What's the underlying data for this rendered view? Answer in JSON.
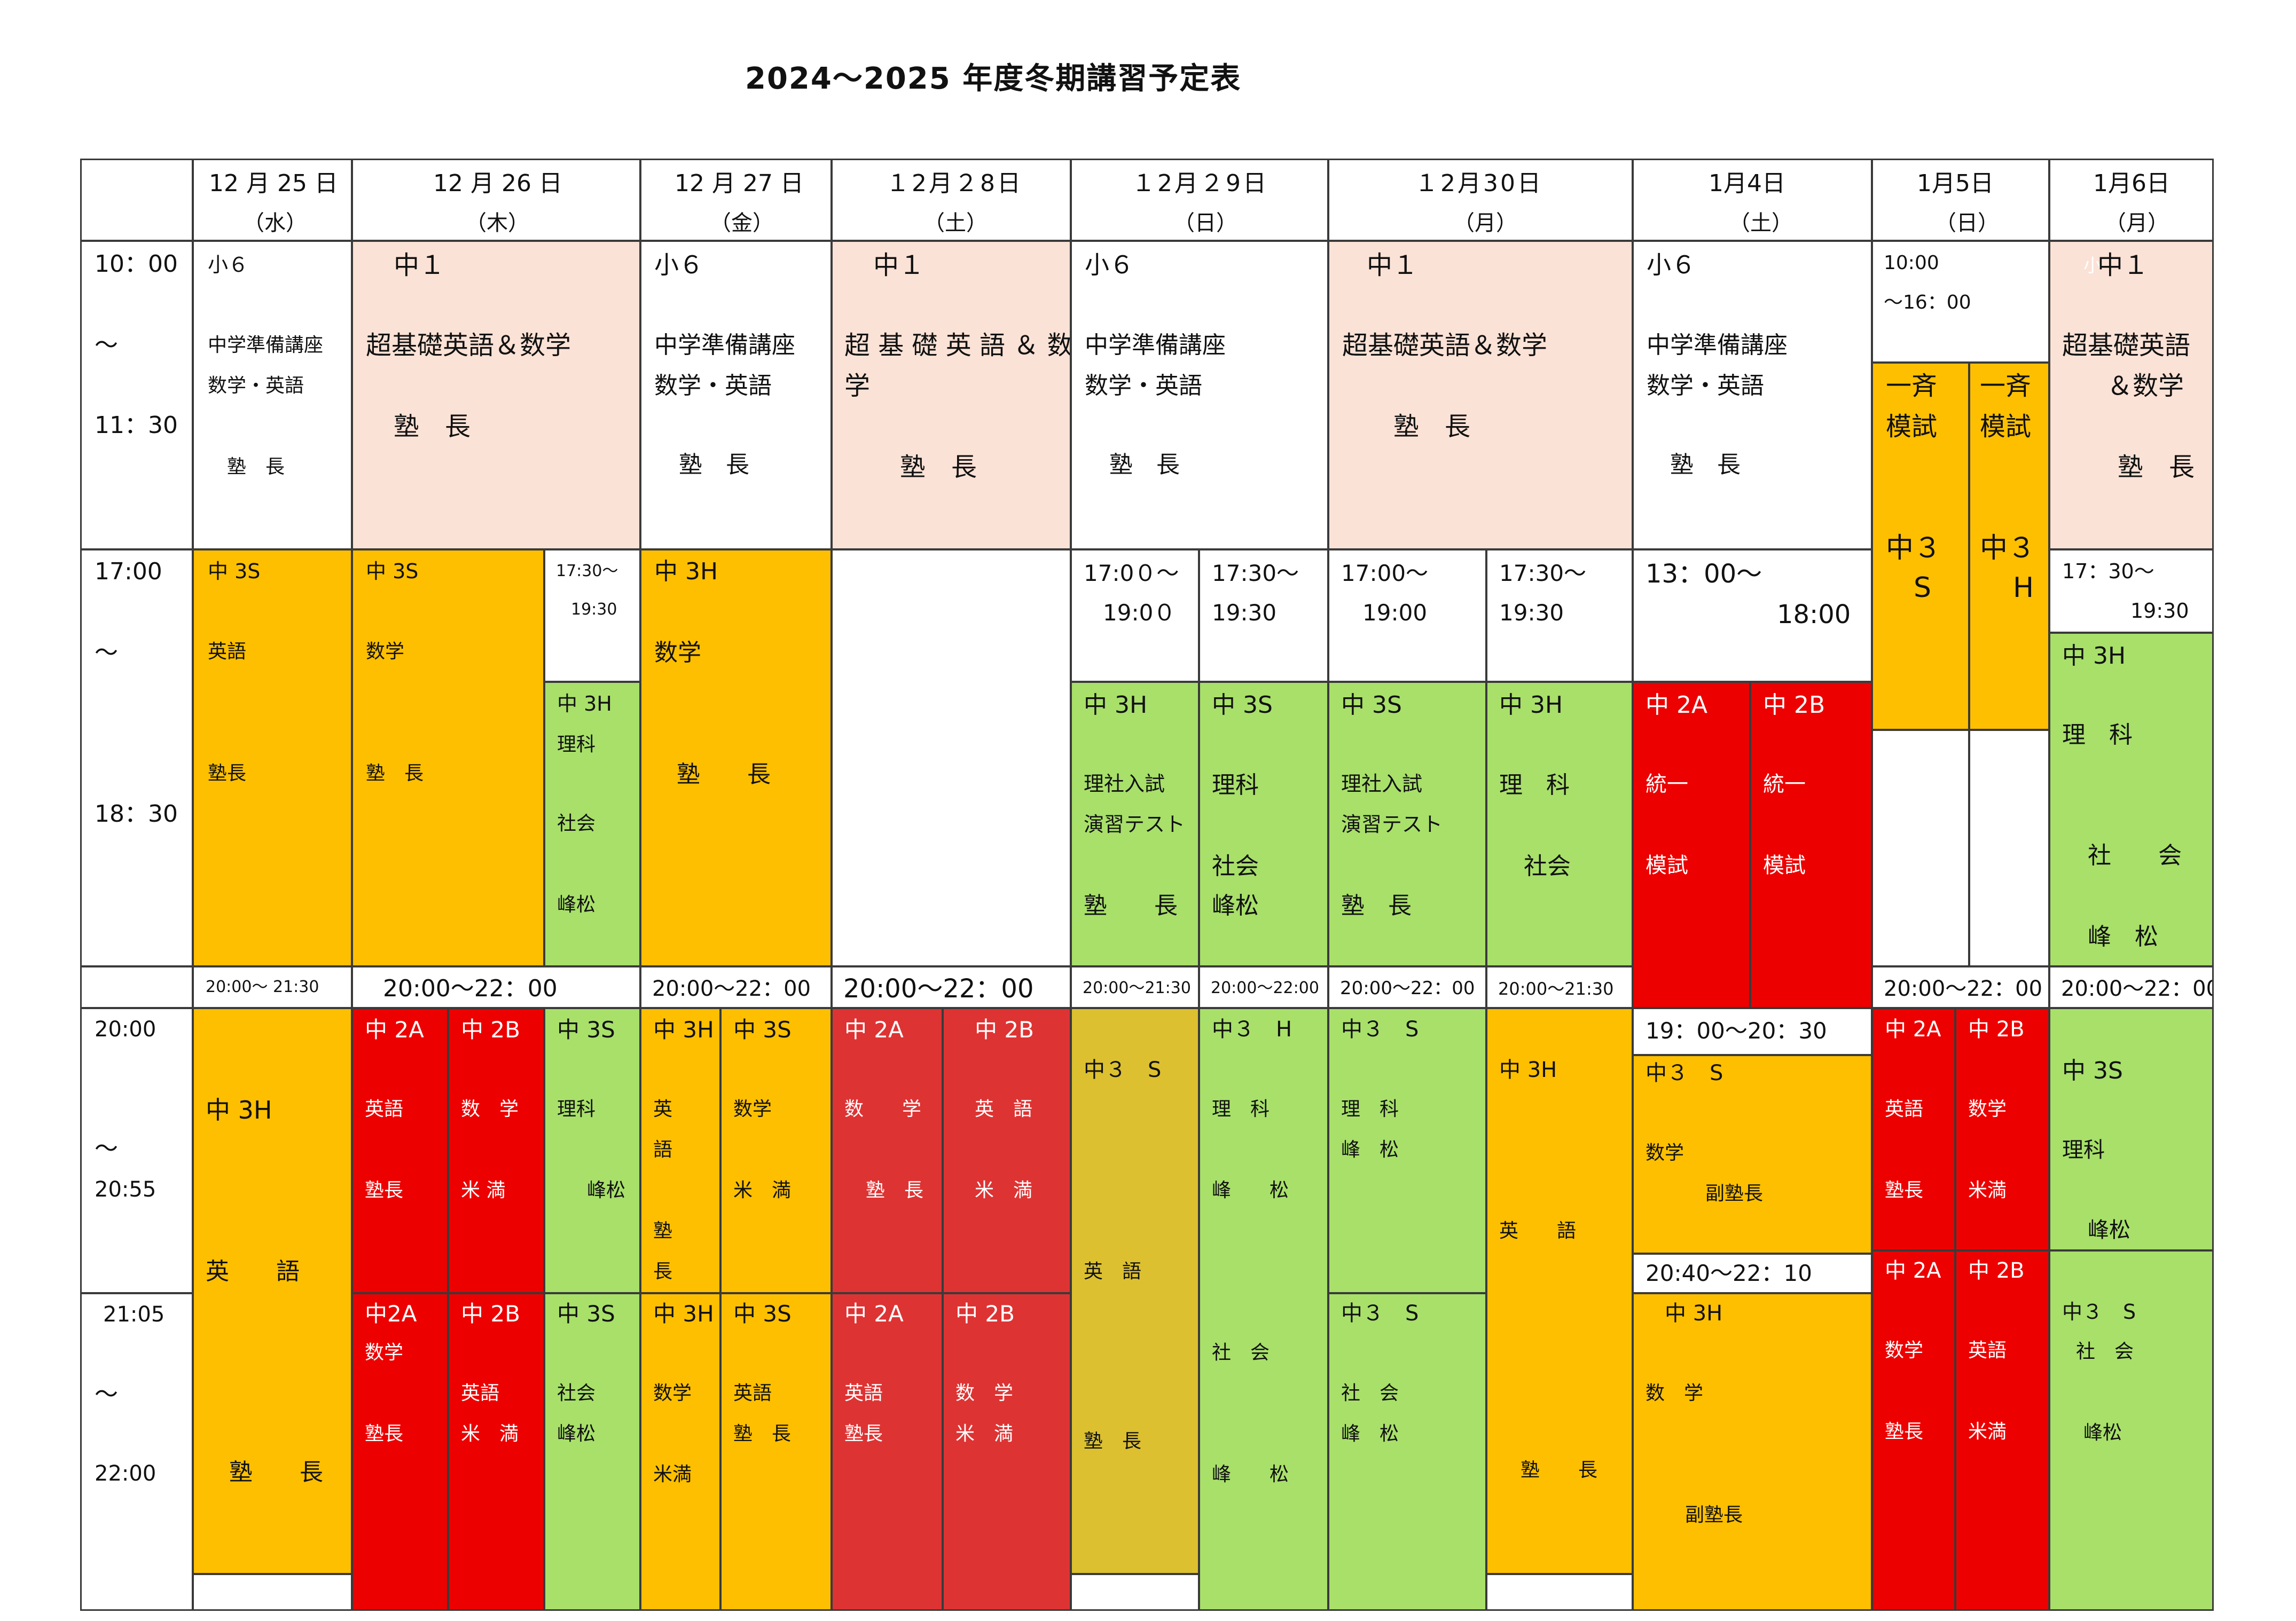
{
  "title": "2024～2025 年度冬期講習予定表",
  "header": {
    "d1": {
      "date": "12 月 25 日",
      "dow": "（水）"
    },
    "d2": {
      "date": "12 月 26 日",
      "dow": "（木）"
    },
    "d3": {
      "date": "12 月 27 日",
      "dow": "（金）"
    },
    "d4": {
      "date": "１2月２8日",
      "dow": "（土）"
    },
    "d5": {
      "date": "１2月２9日",
      "dow": "（日）"
    },
    "d6": {
      "date": "１2月30日",
      "dow": "（月）"
    },
    "d7": {
      "date": "1月4日",
      "dow": "（土）"
    },
    "d8": {
      "date": "1月5日",
      "dow": "（日）"
    },
    "d9": {
      "date": "1月6日",
      "dow": "（月）"
    }
  },
  "times": {
    "morning": {
      "start": "10：00",
      "tilde": "～",
      "end": "11：30"
    },
    "evening": {
      "start": "17:00",
      "tilde": "～",
      "end": "18：30"
    },
    "night1": {
      "start": "20:00",
      "tilde": "～",
      "end": "20:55"
    },
    "night2": {
      "start": "21:05",
      "tilde": "～",
      "end": "22:00"
    }
  },
  "morning": {
    "d1": {
      "l1": "小６",
      "l2": "中学準備講座",
      "l3": "数学・英語",
      "l4": "塾　長"
    },
    "d2": {
      "l1": "中１",
      "l2": "超基礎英語＆数学",
      "l3": "塾　長"
    },
    "d3": {
      "l1": "小６",
      "l2": "中学準備講座",
      "l3": "数学・英語",
      "l4": "塾　長"
    },
    "d4": {
      "l1": "中１",
      "l2": "超 基 礎 英 語 ＆ 数",
      "l3": "学",
      "l4": "塾　長"
    },
    "d5": {
      "l1": "小６",
      "l2": "中学準備講座",
      "l3": "数学・英語",
      "l4": "塾　長"
    },
    "d6": {
      "l1": "中１",
      "l2": "超基礎英語＆数学",
      "l3": "塾　長"
    },
    "d7": {
      "l1": "小６",
      "l2": "中学準備講座",
      "l3": "数学・英語",
      "l4": "塾　長"
    },
    "d8": {
      "time1": "10:00",
      "time2": "～16：00"
    },
    "d8a": {
      "l1": "一斉",
      "l2": "模試",
      "l3": "中３",
      "l4": "S"
    },
    "d8b": {
      "l1": "一斉",
      "l2": "模試",
      "l3": "中３",
      "l4": "H"
    },
    "d9": {
      "prefix": "小",
      "l1": "中１",
      "l2": "超基礎英語",
      "l3": "＆数学",
      "l4": "塾　長"
    }
  },
  "evening": {
    "d1": {
      "l1": "中 3S",
      "l2": "英語",
      "l3": "塾長"
    },
    "d2a": {
      "l1": "中 3S",
      "l2": "数学",
      "l3": "塾　長"
    },
    "d2b_time": {
      "l1": "17:30～",
      "l2": "19:30"
    },
    "d2b": {
      "l1": "中 3H",
      "l2": "理科",
      "l3": "社会",
      "l4": "峰松"
    },
    "d3": {
      "l1": "中 3H",
      "l2": "数学",
      "l3": "塾　　長"
    },
    "d5a_time": {
      "l1": "17:0０～",
      "l2": "19:0０"
    },
    "d5b_time": {
      "l1": "17:30～",
      "l2": "19:30"
    },
    "d6a_time": {
      "l1": "17:00～",
      "l2": "19:00"
    },
    "d6b_time": {
      "l1": "17:30～",
      "l2": "19:30"
    },
    "d7_time": {
      "l1": "13：00～",
      "l2": "18:00"
    },
    "d9_time": {
      "l1": "17：30～",
      "l2": "19:30"
    },
    "d5a": {
      "l1": "中 3H",
      "l2": "理社入試",
      "l3": "演習テスト",
      "l4": "塾　　長"
    },
    "d5b": {
      "l1": "中 3S",
      "l2": "理科",
      "l3": "社会",
      "l4": "峰松"
    },
    "d6a": {
      "l1": "中 3S",
      "l2": "理社入試",
      "l3": "演習テスト",
      "l4": "塾　長"
    },
    "d6b": {
      "l1": "中 3H",
      "l2": "理　科",
      "l3": "社会"
    },
    "d7a": {
      "l1": "中 2A",
      "l2": "統一",
      "l3": "模試"
    },
    "d7b": {
      "l1": "中 2B",
      "l2": "統一",
      "l3": "模試"
    },
    "d9": {
      "l1": "中 3H",
      "l2": "理　科",
      "l3": "社　　会",
      "l4": "峰　松"
    }
  },
  "night_times": {
    "d1": "20:00～ 21:30",
    "d2": "20:00～22：00",
    "d3": "20:00～22：00",
    "d4": "20:00～22：00",
    "d5a": "20:00～21:30",
    "d5b": "20:00～22:00",
    "d6a": "20:00～22：00",
    "d6b": "20:00～21:30",
    "d8": "20:00～22：00",
    "d9": "20:00～22：00",
    "d7_1": "19：00～20：30",
    "d7_2": "20:40～22：10"
  },
  "night": {
    "d1": {
      "l1": "中 3H",
      "l2": "英　　語",
      "l3": "塾　　長"
    },
    "d2a1": {
      "l1": "中 2A",
      "l2": "英語",
      "l3": "塾長"
    },
    "d2b1": {
      "l1": "中 2B",
      "l2": "数　学",
      "l3": "米 満"
    },
    "d2c1": {
      "l1": "中 3S",
      "l2": "理科",
      "l3": "峰松"
    },
    "d2a2": {
      "l1": "中2A",
      "l2": "数学",
      "l3": "塾長"
    },
    "d2b2": {
      "l1": "中 2B",
      "l2": "英語",
      "l3": "米　満"
    },
    "d2c2": {
      "l1": "中 3S",
      "l2": "社会",
      "l3": "峰松"
    },
    "d3a1": {
      "l1": "中 3H",
      "l2": "英",
      "l3": "語",
      "l4": "塾",
      "l5": "長"
    },
    "d3b1": {
      "l1": "中 3S",
      "l2": "数学",
      "l3": "米　満"
    },
    "d3a2": {
      "l1": "中 3H",
      "l2": "数学",
      "l3": "米満"
    },
    "d3b2": {
      "l1": "中 3S",
      "l2": "英語",
      "l3": "塾　長"
    },
    "d4a1": {
      "l1": "中 2A",
      "l2": "数　　学",
      "l3": "塾　長"
    },
    "d4b1": {
      "l1": "中 2B",
      "l2": "英　語",
      "l3": "米　満"
    },
    "d4a2": {
      "l1": "中 2A",
      "l2": "英語",
      "l3": "塾長"
    },
    "d4b2": {
      "l1": "中 2B",
      "l2": "数　学",
      "l3": "米　満"
    },
    "d5a": {
      "l1": "中３　S",
      "l2": "英　語",
      "l3": "塾　長"
    },
    "d5b": {
      "l1": "中３　H",
      "l2": "理　科",
      "l3": "峰　　松",
      "l4": "社　会",
      "l5": "峰　　松"
    },
    "d6a1": {
      "l1": "中３　S",
      "l2": "理　科",
      "l3": "峰　松"
    },
    "d6a2": {
      "l1": "中３　S",
      "l2": "社　会",
      "l3": "峰　松"
    },
    "d6b": {
      "l1": "中 3H",
      "l2": "英　　語",
      "l3": "塾　　長"
    },
    "d7_1": {
      "l1": "中３　S",
      "l2": "数学",
      "l3": "副塾長"
    },
    "d7_2": {
      "l1": "中 3H",
      "l2": "数　学",
      "l3": "副塾長"
    },
    "d8a1": {
      "l1": "中 2A",
      "l2": "英語",
      "l3": "塾長"
    },
    "d8b1": {
      "l1": "中 2B",
      "l2": "数学",
      "l3": "米満"
    },
    "d8a2": {
      "l1": "中 2A",
      "l2": "数学",
      "l3": "塾長"
    },
    "d8b2": {
      "l1": "中 2B",
      "l2": "英語",
      "l3": "米満"
    },
    "d9_1": {
      "l1": "中 3S",
      "l2": "理科",
      "l3": "峰松"
    },
    "d9_2": {
      "l1": "中３　S",
      "l2": "社　会",
      "l3": "峰松"
    }
  }
}
